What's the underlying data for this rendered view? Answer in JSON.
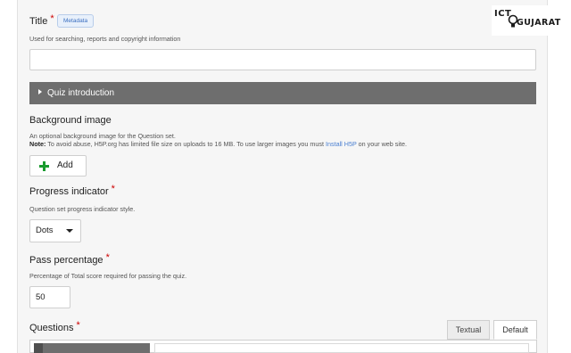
{
  "title_field": {
    "label": "Title",
    "required_mark": "*",
    "metadata_button": "Metadata",
    "description": "Used for searching, reports and copyright information",
    "value": ""
  },
  "quiz_intro": {
    "label": "Quiz introduction"
  },
  "background_image": {
    "label": "Background image",
    "description": "An optional background image for the Question set.",
    "note_label": "Note:",
    "note_text": " To avoid abuse, H5P.org has limited file size on uploads to 16 MB. To use larger images you must ",
    "note_link": "Install H5P",
    "note_end": " on your web site.",
    "add_button": "Add"
  },
  "progress_indicator": {
    "label": "Progress indicator",
    "required_mark": "*",
    "description": "Question set progress indicator style.",
    "selected": "Dots"
  },
  "pass_percentage": {
    "label": "Pass percentage",
    "required_mark": "*",
    "description": "Percentage of Total score required for passing the quiz.",
    "value": "50"
  },
  "questions": {
    "label": "Questions",
    "required_mark": "*",
    "tabs": [
      "Textual",
      "Default"
    ],
    "active_tab": "Default"
  },
  "logo": {
    "ict": "ICT",
    "gujarat": "GUJARAT"
  },
  "colors": {
    "accordion": "#6e6e6e",
    "required": "#cc0000",
    "link": "#4a7fd1",
    "add_icon": "#1a9b2e"
  }
}
